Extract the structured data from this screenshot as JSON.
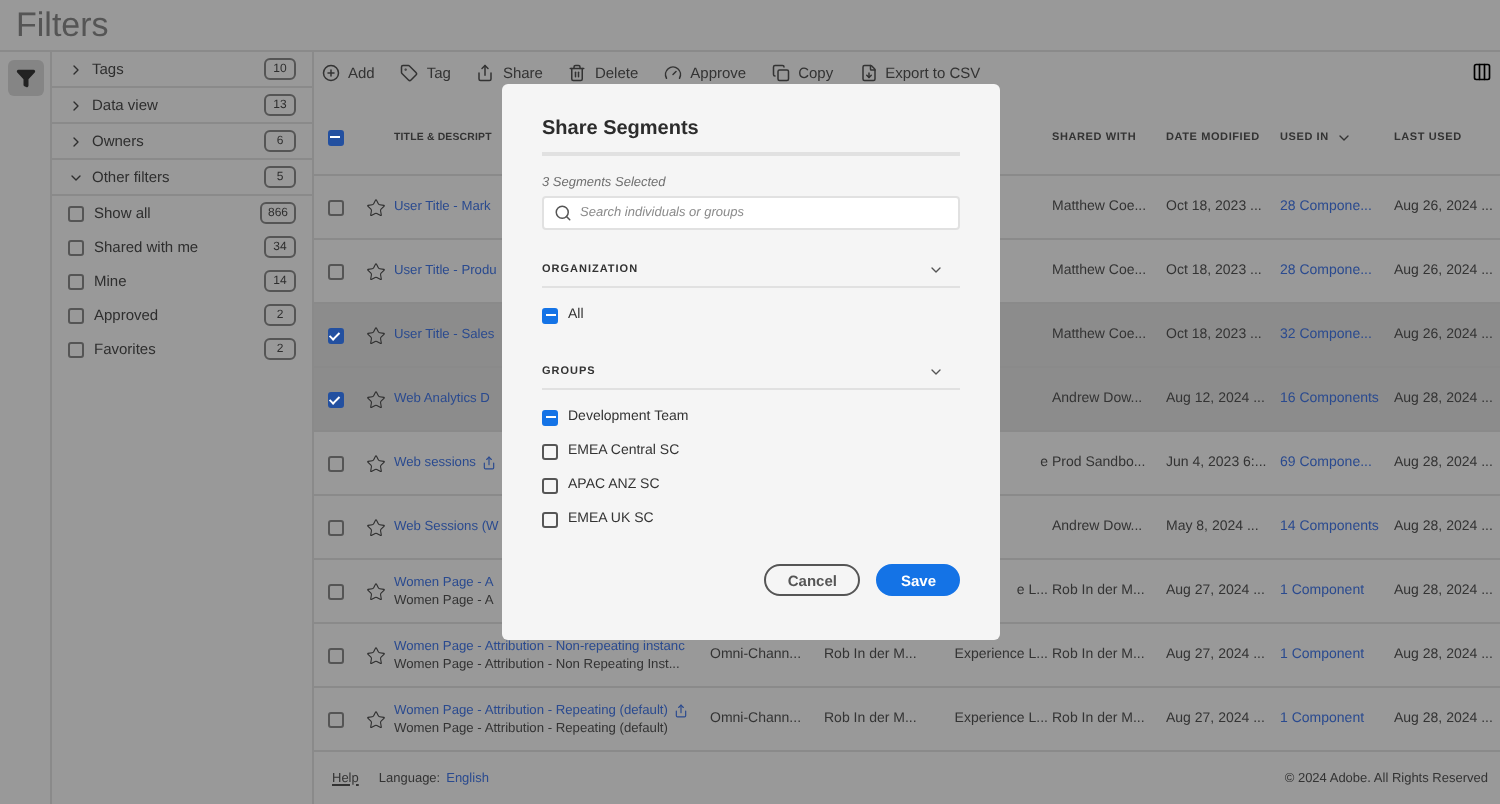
{
  "page_title": "Filters",
  "filter_groups": [
    {
      "label": "Tags",
      "count": "10",
      "expanded": false
    },
    {
      "label": "Data view",
      "count": "13",
      "expanded": false
    },
    {
      "label": "Owners",
      "count": "6",
      "expanded": false
    },
    {
      "label": "Other filters",
      "count": "5",
      "expanded": true,
      "options": [
        {
          "label": "Show all",
          "count": "866",
          "checked": false
        },
        {
          "label": "Shared with me",
          "count": "34",
          "checked": false
        },
        {
          "label": "Mine",
          "count": "14",
          "checked": false
        },
        {
          "label": "Approved",
          "count": "2",
          "checked": false
        },
        {
          "label": "Favorites",
          "count": "2",
          "checked": false
        }
      ]
    }
  ],
  "toolbar": [
    {
      "label": "Add",
      "kind": "add"
    },
    {
      "label": "Tag",
      "kind": "tag"
    },
    {
      "label": "Share",
      "kind": "share"
    },
    {
      "label": "Delete",
      "kind": "delete"
    },
    {
      "label": "Approve",
      "kind": "approve"
    },
    {
      "label": "Copy",
      "kind": "copy"
    },
    {
      "label": "Export to CSV",
      "kind": "export"
    }
  ],
  "table": {
    "header_checkbox": {
      "mixed": true
    },
    "columns": [
      {
        "label": "TITLE & DESCRIPT",
        "sorted": false
      },
      {
        "label": "SHARED WITH",
        "sorted": false
      },
      {
        "label": "DATE MODIFIED",
        "sorted": false
      },
      {
        "label": "USED IN",
        "sorted": true
      },
      {
        "label": "LAST USED",
        "sorted": false
      }
    ],
    "rows": [
      {
        "checked": false,
        "favorite": false,
        "title": "User Title - Mark",
        "shared": false,
        "shared_with": "Matthew Coe...",
        "date_modified": "Oct 18, 2023 ...",
        "used_in": "28 Compone...",
        "last_used": "Aug 26, 2024 ..."
      },
      {
        "checked": false,
        "favorite": false,
        "title": "User Title - Produ",
        "shared": false,
        "shared_with": "Matthew Coe...",
        "date_modified": "Oct 18, 2023 ...",
        "used_in": "28 Compone...",
        "last_used": "Aug 26, 2024 ..."
      },
      {
        "checked": true,
        "favorite": false,
        "title": "User Title - Sales",
        "shared": false,
        "shared_with": "Matthew Coe...",
        "date_modified": "Oct 18, 2023 ...",
        "used_in": "32 Compone...",
        "last_used": "Aug 26, 2024 ..."
      },
      {
        "checked": true,
        "favorite": false,
        "title": "Web Analytics D",
        "shared": false,
        "shared_with": "Andrew Dow...",
        "date_modified": "Aug 12, 2024 ...",
        "used_in": "16 Components",
        "last_used": "Aug 28, 2024 ..."
      },
      {
        "checked": false,
        "favorite": false,
        "title": "Web sessions",
        "shared": true,
        "column_3": "e",
        "shared_with": "Prod Sandbo...",
        "date_modified": "Jun 4, 2023 6:...",
        "used_in": "69 Compone...",
        "last_used": "Aug 28, 2024 ..."
      },
      {
        "checked": false,
        "favorite": false,
        "title": "Web Sessions (W",
        "shared": false,
        "shared_with": "Andrew Dow...",
        "date_modified": "May 8, 2024 ...",
        "used_in": "14 Components",
        "last_used": "Aug 28, 2024 ..."
      },
      {
        "checked": false,
        "favorite": false,
        "title": "Women Page - A",
        "description": "Women Page - A",
        "shared": false,
        "column_3": "e L...",
        "shared_with": "Rob In der M...",
        "date_modified": "Aug 27, 2024 ...",
        "used_in": "1 Component",
        "last_used": "Aug 28, 2024 ..."
      },
      {
        "checked": false,
        "favorite": false,
        "title": "Women Page - Attribution - Non-repeating instanc",
        "description": "Women Page - Attribution - Non Repeating Inst...",
        "shared": false,
        "column_1": "Omni-Chann...",
        "column_2": "Rob In der M...",
        "column_3": "Experience L...",
        "shared_with": "Rob In der M...",
        "date_modified": "Aug 27, 2024 ...",
        "used_in": "1 Component",
        "last_used": "Aug 28, 2024 ..."
      },
      {
        "checked": false,
        "favorite": false,
        "title": "Women Page - Attribution - Repeating (default)",
        "description": "Women Page - Attribution - Repeating (default)",
        "shared": true,
        "column_1": "Omni-Chann...",
        "column_2": "Rob In der M...",
        "column_3": "Experience L...",
        "shared_with": "Rob In der M...",
        "date_modified": "Aug 27, 2024 ...",
        "used_in": "1 Component",
        "last_used": "Aug 28, 2024 ..."
      }
    ]
  },
  "footer": {
    "help": "Help",
    "language_label": "Language:",
    "language": "English",
    "copyright": "© 2024 Adobe. All Rights Reserved"
  },
  "dialog": {
    "title": "Share Segments",
    "selection_note": "3 Segments Selected",
    "search": {
      "placeholder": "Search individuals or groups"
    },
    "sections": [
      {
        "heading": "ORGANIZATION",
        "expanded": true,
        "options": [
          {
            "label": "All",
            "mixed": true
          }
        ]
      },
      {
        "heading": "GROUPS",
        "expanded": true,
        "options": [
          {
            "label": "Development Team",
            "mixed": true
          },
          {
            "label": "EMEA Central SC",
            "checked": false,
            "mixed": false
          },
          {
            "label": "APAC ANZ SC",
            "checked": false,
            "mixed": false
          },
          {
            "label": "EMEA UK SC",
            "checked": false,
            "mixed": false
          }
        ]
      }
    ],
    "buttons": [
      {
        "label": "Cancel",
        "kind": "secondary"
      },
      {
        "label": "Save",
        "kind": "primary"
      }
    ]
  }
}
